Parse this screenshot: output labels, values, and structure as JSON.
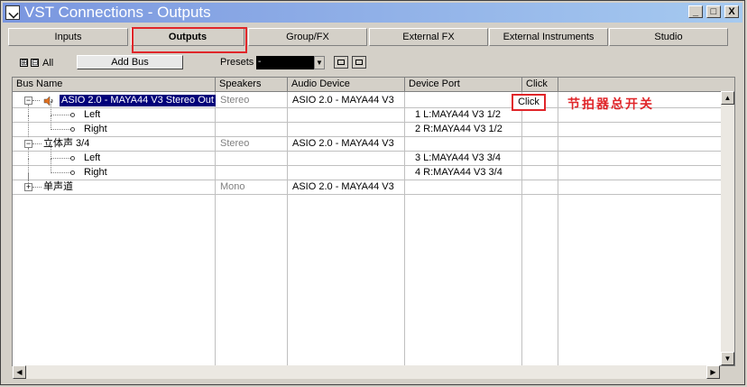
{
  "window": {
    "title": "VST Connections - Outputs",
    "minimize_label": "_",
    "maximize_label": "□",
    "close_label": "X"
  },
  "tabs": [
    {
      "label": "Inputs",
      "active": false
    },
    {
      "label": "Outputs",
      "active": true
    },
    {
      "label": "Group/FX",
      "active": false
    },
    {
      "label": "External FX",
      "active": false
    },
    {
      "label": "External Instruments",
      "active": false
    },
    {
      "label": "Studio",
      "active": false
    }
  ],
  "toolbar": {
    "expand_all_label": "⊞",
    "collapse_all_label": "⊟",
    "all_label": "All",
    "add_bus_label": "Add Bus",
    "presets_label": "Presets",
    "preset_value": "-"
  },
  "table": {
    "headers": {
      "bus_name": "Bus Name",
      "speakers": "Speakers",
      "audio_device": "Audio Device",
      "device_port": "Device Port",
      "click": "Click"
    },
    "rows": [
      {
        "name": "ASIO 2.0 - MAYA44 V3 Stereo Out",
        "speakers": "Stereo",
        "audio_device": "ASIO 2.0 - MAYA44 V3",
        "device_port": "",
        "click": "Click"
      },
      {
        "name": "Left",
        "speakers": "",
        "audio_device": "",
        "device_port": "1 L:MAYA44 V3 1/2",
        "click": ""
      },
      {
        "name": "Right",
        "speakers": "",
        "audio_device": "",
        "device_port": "2 R:MAYA44 V3 1/2",
        "click": ""
      },
      {
        "name": "立体声 3/4",
        "speakers": "Stereo",
        "audio_device": "ASIO 2.0 - MAYA44 V3",
        "device_port": "",
        "click": ""
      },
      {
        "name": "Left",
        "speakers": "",
        "audio_device": "",
        "device_port": "3 L:MAYA44 V3 3/4",
        "click": ""
      },
      {
        "name": "Right",
        "speakers": "",
        "audio_device": "",
        "device_port": "4 R:MAYA44 V3 3/4",
        "click": ""
      },
      {
        "name": "单声道",
        "speakers": "Mono",
        "audio_device": "ASIO 2.0 - MAYA44 V3",
        "device_port": "",
        "click": ""
      }
    ]
  },
  "annotation": {
    "text": "节拍器总开关",
    "color": "#e0262a"
  },
  "scrollbars": {
    "up": "▲",
    "down": "▼",
    "left": "◀",
    "right": "▶"
  },
  "colors": {
    "highlight_box": "#e0262a",
    "selection": "#00007a",
    "titlebar_start": "#7a96df",
    "titlebar_end": "#a6caf0"
  }
}
